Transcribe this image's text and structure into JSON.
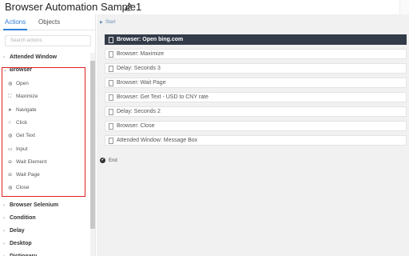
{
  "app": {
    "title": "Browser Automation Sample1"
  },
  "left_panel": {
    "tabs": [
      "Actions",
      "Objects"
    ],
    "active_tab": "Actions",
    "search_placeholder": "Search actions",
    "categories_top": [
      "Attended Window"
    ],
    "browser_category": "Browser",
    "browser_items": [
      {
        "label": "Open",
        "icon": "globe-icon"
      },
      {
        "label": "Maximize",
        "icon": "maximize-icon"
      },
      {
        "label": "Navigate",
        "icon": "navigate-icon"
      },
      {
        "label": "Click",
        "icon": "click-icon"
      },
      {
        "label": "Get Text",
        "icon": "globe-icon"
      },
      {
        "label": "Input",
        "icon": "keyboard-icon"
      },
      {
        "label": "Wait Element",
        "icon": "wait-icon"
      },
      {
        "label": "Wait Page",
        "icon": "wait-icon"
      },
      {
        "label": "Close",
        "icon": "globe-icon"
      }
    ],
    "categories_bottom": [
      "Browser Selenium",
      "Condition",
      "Delay",
      "Desktop",
      "Dictionary"
    ]
  },
  "canvas": {
    "start_label": "Start",
    "end_label": "End",
    "steps": [
      {
        "label": "Browser: Open bing.com",
        "selected": true
      },
      {
        "label": "Browser: Maximize",
        "selected": false
      },
      {
        "label": "Delay: Seconds 3",
        "selected": false
      },
      {
        "label": "Browser: Wait Page",
        "selected": false
      },
      {
        "label": "Browser: Get Text - USD to CNY rate",
        "selected": false
      },
      {
        "label": "Delay: Seconds 2",
        "selected": false
      },
      {
        "label": "Browser: Close",
        "selected": false
      },
      {
        "label": "Attended Window: Message Box",
        "selected": false
      }
    ]
  },
  "colors": {
    "accent": "#2f7fd8",
    "highlight_border": "#e02020",
    "selected_step_bg": "#333b49"
  }
}
